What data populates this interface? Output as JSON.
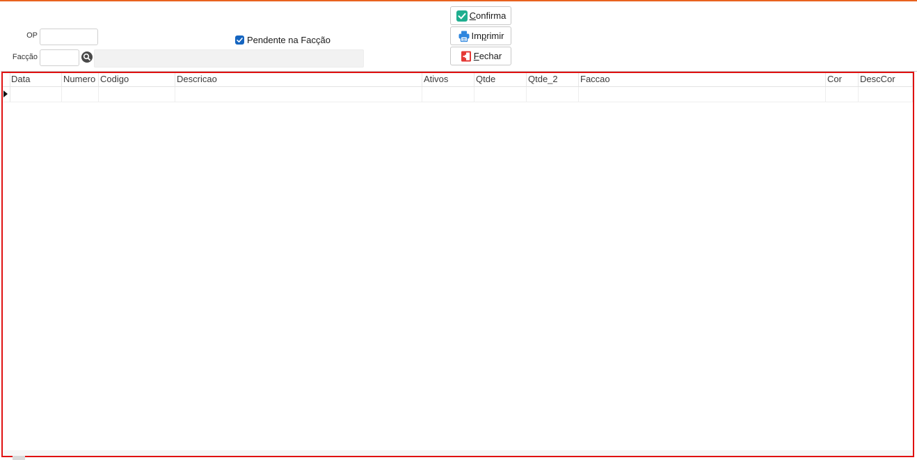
{
  "colors": {
    "accent": "#e8621f",
    "checkbox": "#1565c0",
    "confirm_icon": "#1fae8f",
    "print_icon": "#2e86de",
    "close_icon": "#e53935",
    "frame_highlight": "#e01010"
  },
  "filters": {
    "op_label": "OP",
    "op_value": "",
    "faccao_label": "Facção",
    "faccao_value": "",
    "faccao_description": "",
    "search_icon": "search-icon",
    "pendente_label": "Pendente na Facção",
    "pendente_checked": true
  },
  "actions": {
    "confirma": {
      "label": "Confirma",
      "mnemonic": "C",
      "rest": "onfirma",
      "icon": "check-icon"
    },
    "imprimir": {
      "label": "Imprimir",
      "prefix": "Im",
      "mnemonic": "p",
      "rest": "rimir",
      "icon": "printer-icon"
    },
    "fechar": {
      "label": "Fechar",
      "mnemonic": "F",
      "rest": "echar",
      "icon": "exit-icon"
    }
  },
  "grid": {
    "columns": [
      "Data",
      "Numero",
      "Codigo",
      "Descricao",
      "Ativos",
      "Qtde",
      "Qtde_2",
      "Faccao",
      "Cor",
      "DescCor"
    ],
    "rows": [
      [
        "",
        "",
        "",
        "",
        "",
        "",
        "",
        "",
        "",
        ""
      ]
    ]
  }
}
